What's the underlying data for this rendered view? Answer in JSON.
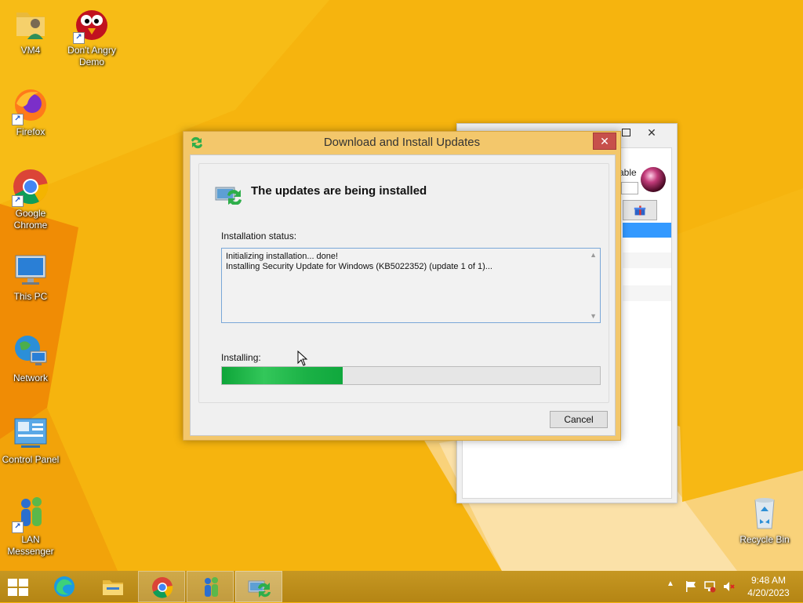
{
  "desktop": {
    "icons": [
      {
        "label": "VM4"
      },
      {
        "label": "Don't Angry Demo"
      },
      {
        "label": "Firefox"
      },
      {
        "label": "Google Chrome"
      },
      {
        "label": "This PC"
      },
      {
        "label": "Network"
      },
      {
        "label": "Control Panel"
      },
      {
        "label": "LAN Messenger"
      },
      {
        "label": "Recycle Bin"
      }
    ]
  },
  "background_window": {
    "partial_text": "able",
    "close_glyph": "✕"
  },
  "dialog": {
    "title": "Download and Install Updates",
    "close_glyph": "✕",
    "header": "The updates are being installed",
    "status_label": "Installation status:",
    "status_lines": [
      "Initializing installation... done!",
      "Installing Security Update for Windows (KB5022352) (update 1 of 1)..."
    ],
    "installing_label": "Installing:",
    "progress_fraction": 0.32,
    "cancel_label": "Cancel"
  },
  "taskbar": {
    "apps": [
      "start",
      "edge",
      "file-explorer",
      "chrome",
      "lan-messenger",
      "windows-update"
    ],
    "active_app": "windows-update",
    "tray": {
      "show_hidden_glyph": "▲"
    },
    "clock": {
      "time": "9:48 AM",
      "date": "4/20/2023"
    }
  },
  "colors": {
    "wallpaper": "#f6b40e",
    "dialog_frame": "#f3c76b",
    "close_button": "#c7504b",
    "progress": "#1bb146",
    "taskbar": "#b98a18"
  }
}
